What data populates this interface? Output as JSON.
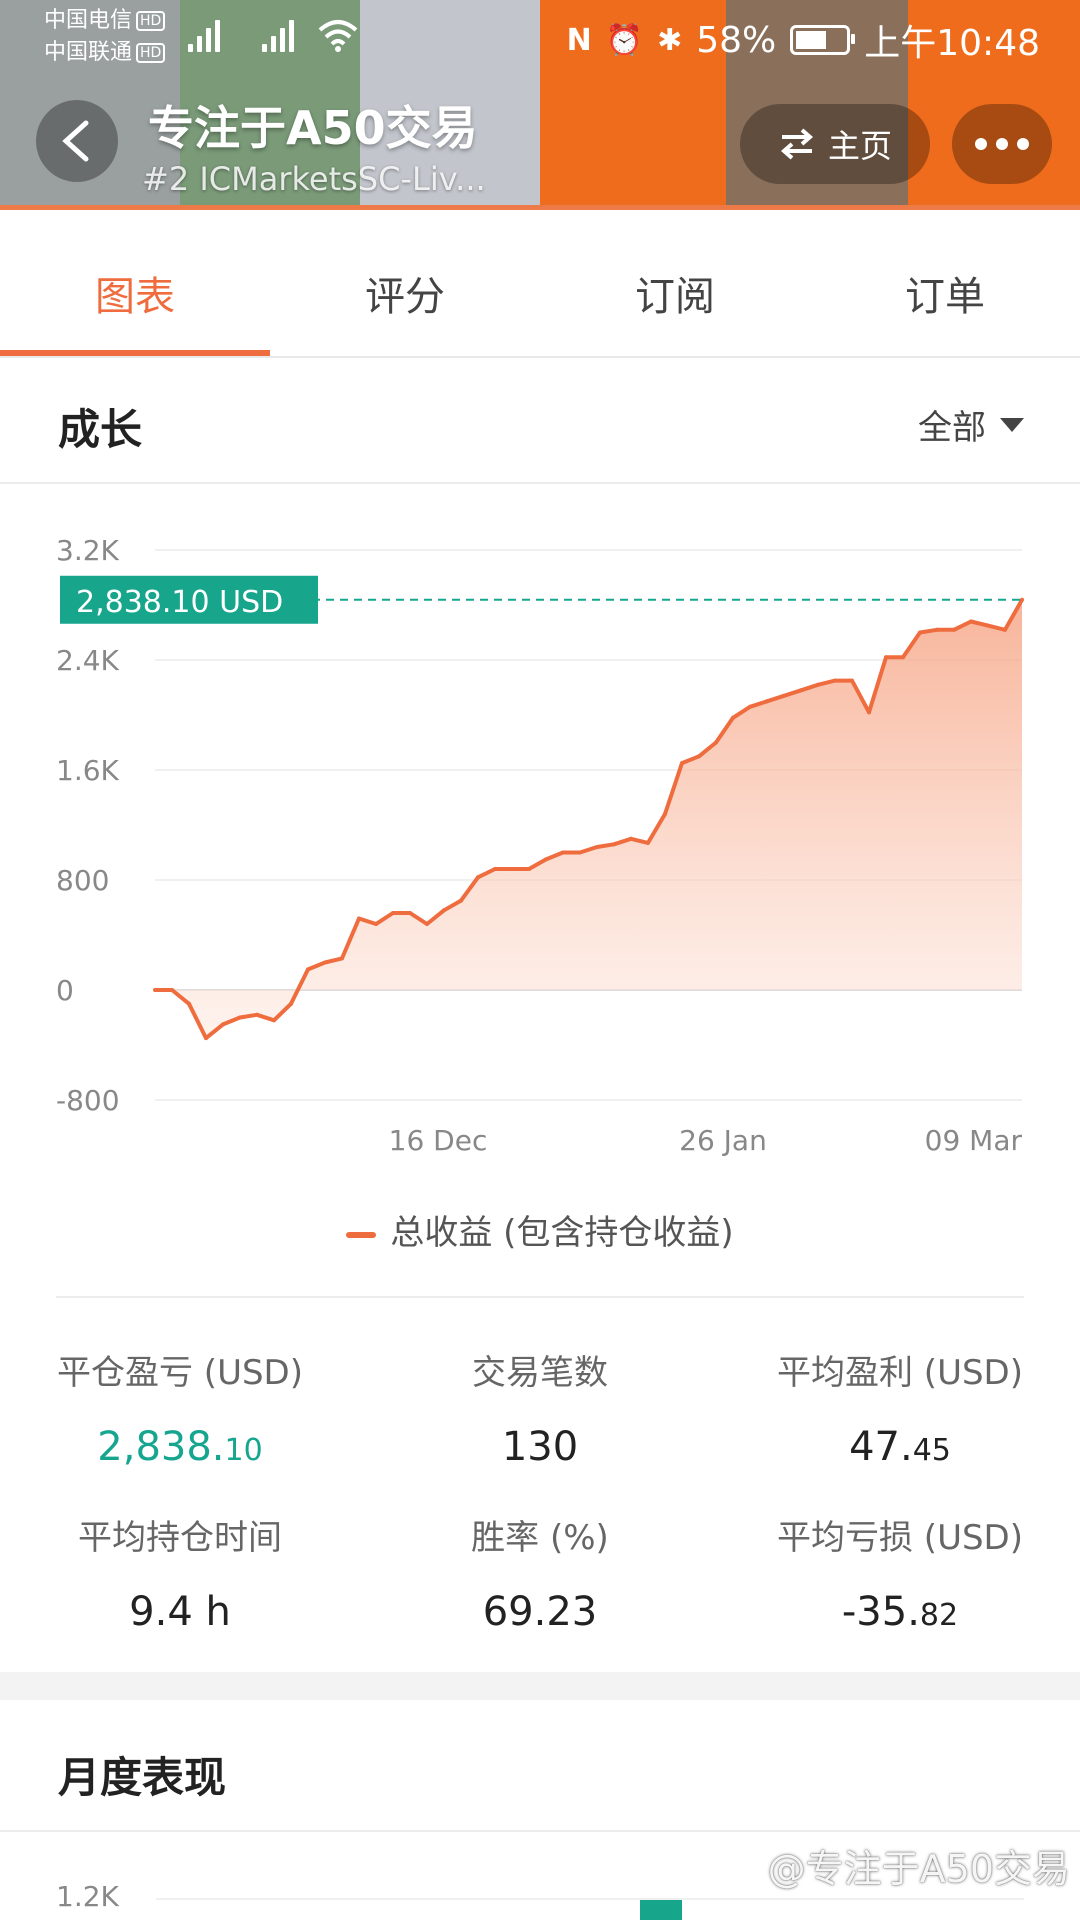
{
  "status_bar": {
    "carrier1": "中国电信",
    "carrier2": "中国联通",
    "hd": "HD",
    "net": "4G",
    "battery": "58%",
    "time": "上午10:48"
  },
  "header": {
    "title": "专注于A50交易",
    "subtitle": "#2 ICMarketsSC-Liv...",
    "home_label": "主页"
  },
  "tabs": [
    {
      "label": "图表",
      "active": true
    },
    {
      "label": "评分",
      "active": false
    },
    {
      "label": "订阅",
      "active": false
    },
    {
      "label": "订单",
      "active": false
    }
  ],
  "growth": {
    "title": "成长",
    "range_label": "全部",
    "legend_label": "总收益 (包含持仓收益)"
  },
  "chart_data": {
    "type": "area",
    "ylim": [
      -800,
      3200
    ],
    "y_ticks": [
      "3.2K",
      "2.4K",
      "1.6K",
      "800",
      "0",
      "-800"
    ],
    "y_tick_values": [
      3200,
      2400,
      1600,
      800,
      0,
      -800
    ],
    "x_ticks": [
      "16 Dec",
      "26 Jan",
      "09 Mar"
    ],
    "current_value_label": "2,838.10 USD",
    "current_value": 2838.1,
    "series": [
      {
        "name": "总收益 (包含持仓收益)",
        "color": "#ef6c3f",
        "values": [
          0,
          0,
          -100,
          -350,
          -250,
          -200,
          -180,
          -220,
          -100,
          150,
          200,
          230,
          520,
          480,
          560,
          560,
          480,
          580,
          650,
          820,
          880,
          880,
          880,
          950,
          1000,
          1000,
          1040,
          1060,
          1100,
          1070,
          1280,
          1650,
          1700,
          1800,
          1980,
          2060,
          2100,
          2140,
          2180,
          2220,
          2250,
          2250,
          2020,
          2420,
          2420,
          2600,
          2620,
          2620,
          2680,
          2650,
          2620,
          2838.1
        ]
      }
    ]
  },
  "stats": [
    {
      "label": "平仓盈亏 (USD)",
      "int": "2,838.",
      "dec": "10",
      "green": true
    },
    {
      "label": "交易笔数",
      "int": "130",
      "dec": "",
      "green": false
    },
    {
      "label": "平均盈利 (USD)",
      "int": "47.",
      "dec": "45",
      "green": false
    },
    {
      "label": "平均持仓时间",
      "int": "9.4 h",
      "dec": "",
      "green": false
    },
    {
      "label": "胜率 (%)",
      "int": "69.23",
      "dec": "",
      "green": false
    },
    {
      "label": "平均亏损 (USD)",
      "int": "-35.",
      "dec": "82",
      "green": false
    }
  ],
  "monthly": {
    "title": "月度表现",
    "tick": "1.2K"
  },
  "watermark": "@专注于A50交易",
  "colors": {
    "accent": "#ef6c3f",
    "profit": "#16a58f"
  }
}
